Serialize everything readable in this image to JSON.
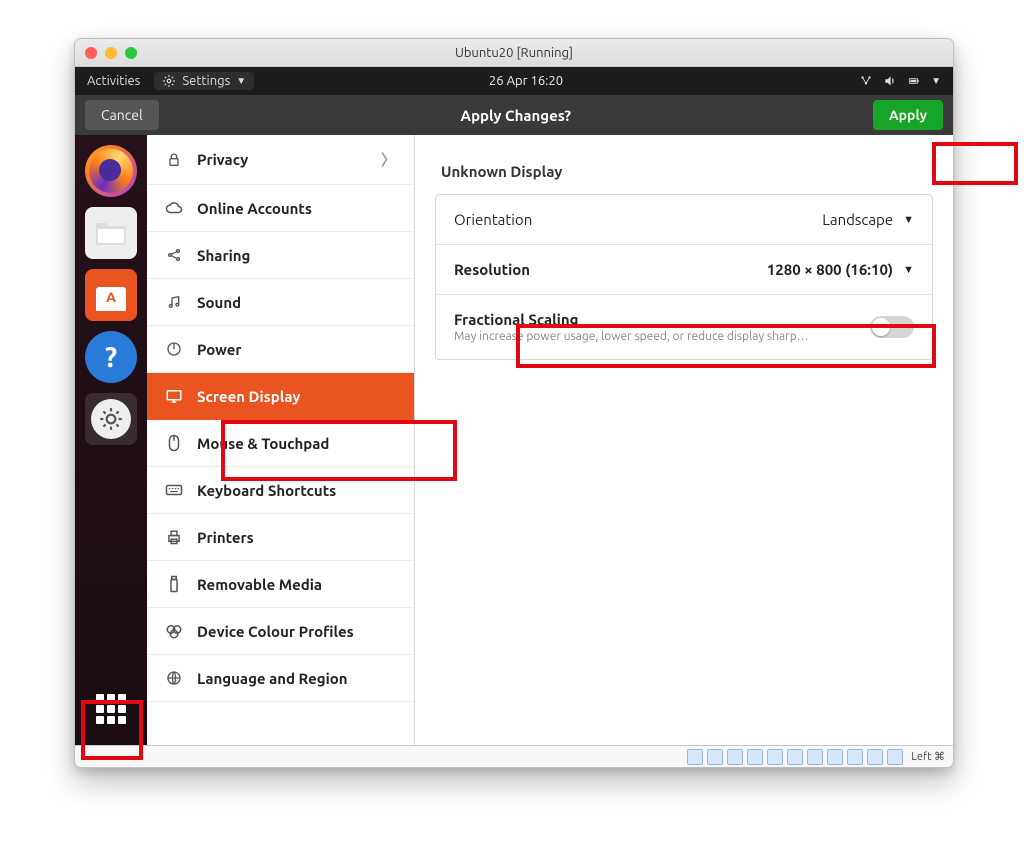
{
  "window": {
    "title": "Ubuntu20 [Running]"
  },
  "gnome_top": {
    "activities": "Activities",
    "app_menu": "Settings",
    "clock": "26 Apr  16:20"
  },
  "action_bar": {
    "cancel": "Cancel",
    "title": "Apply Changes?",
    "apply": "Apply"
  },
  "sidebar": {
    "items": [
      {
        "label": "Privacy",
        "has_sub": true
      },
      {
        "label": "Online Accounts"
      },
      {
        "label": "Sharing"
      },
      {
        "label": "Sound"
      },
      {
        "label": "Power"
      },
      {
        "label": "Screen Display",
        "active": true
      },
      {
        "label": "Mouse & Touchpad"
      },
      {
        "label": "Keyboard Shortcuts"
      },
      {
        "label": "Printers"
      },
      {
        "label": "Removable Media"
      },
      {
        "label": "Device Colour Profiles"
      },
      {
        "label": "Language and Region"
      }
    ]
  },
  "display": {
    "section_title": "Unknown Display",
    "orientation_label": "Orientation",
    "orientation_value": "Landscape",
    "resolution_label": "Resolution",
    "resolution_value": "1280 × 800 (16:10)",
    "fractional_label": "Fractional Scaling",
    "fractional_sub": "May increase power usage, lower speed, or reduce display sharp…"
  },
  "statusbar": {
    "right_text": "Left ⌘"
  }
}
